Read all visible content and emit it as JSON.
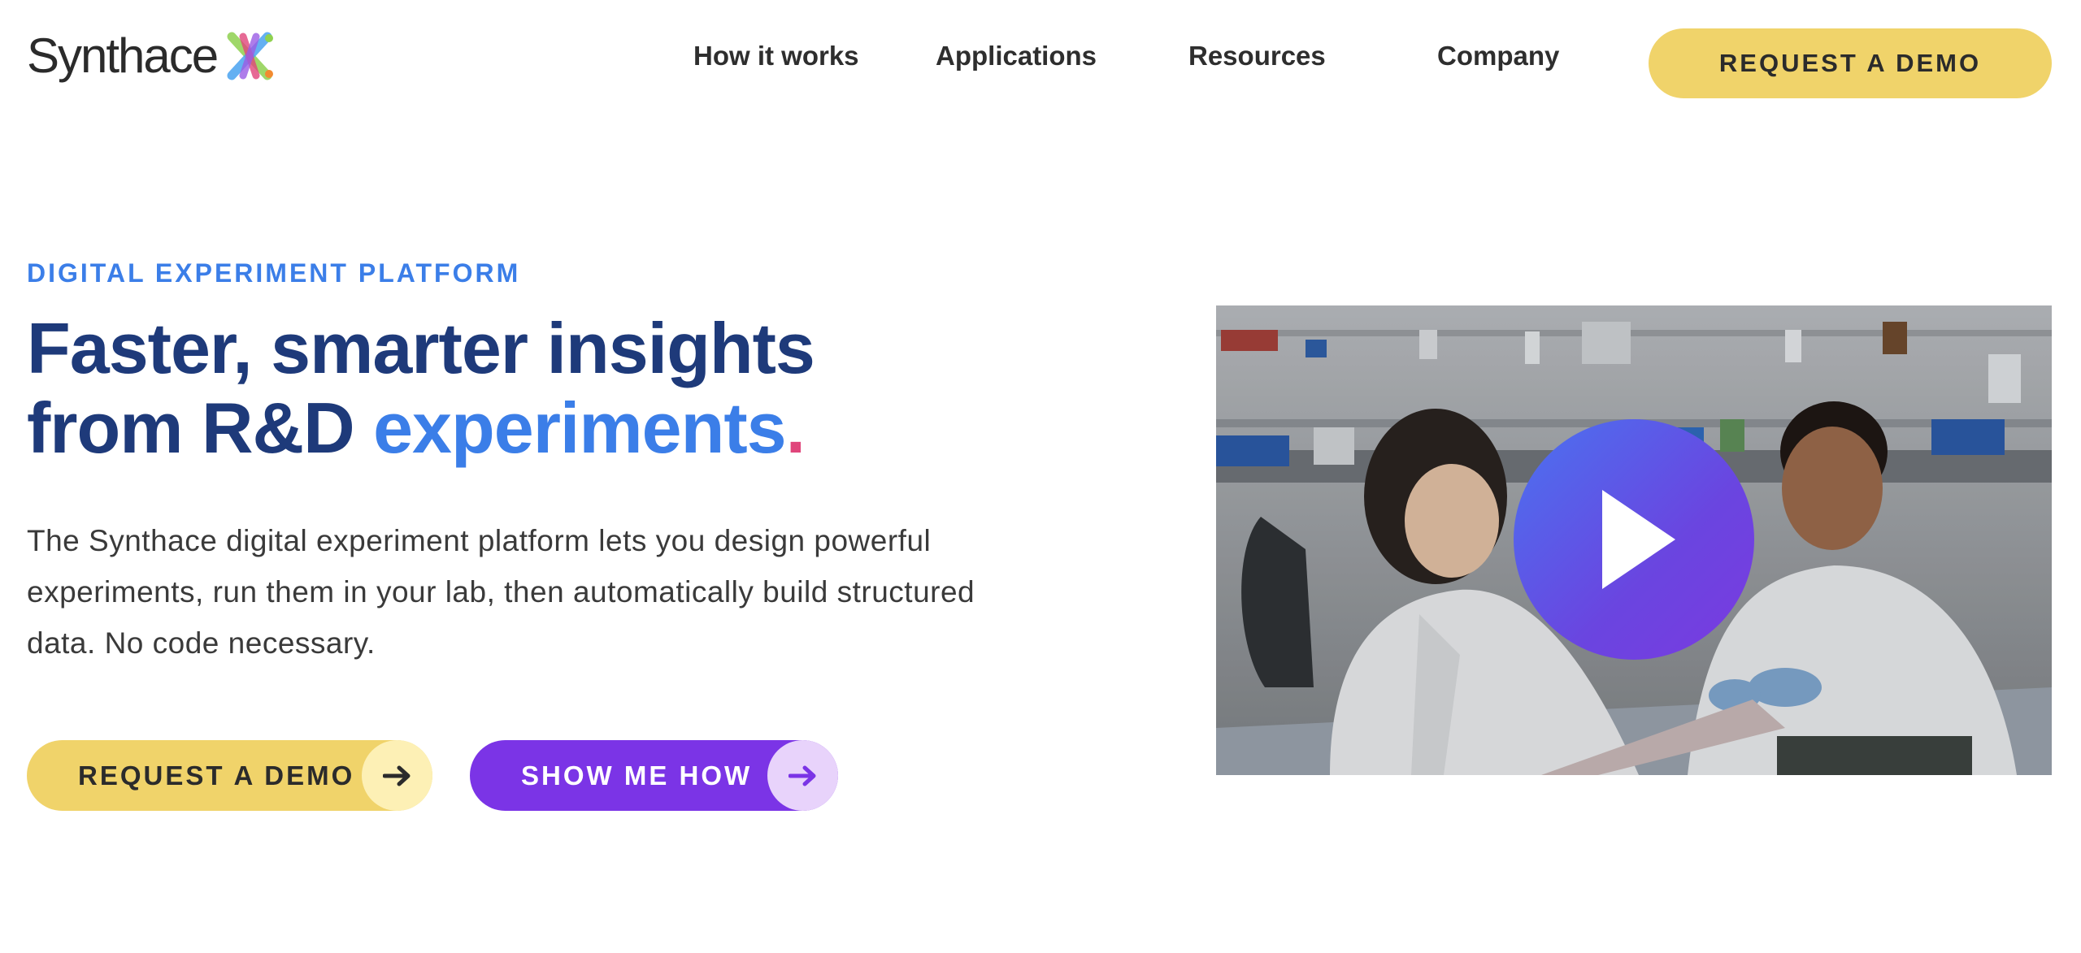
{
  "brand": {
    "name": "Synthace",
    "logo_icon": "synthace-x-mark-icon"
  },
  "nav": {
    "items": [
      {
        "label": "How it works"
      },
      {
        "label": "Applications"
      },
      {
        "label": "Resources"
      },
      {
        "label": "Company"
      }
    ],
    "cta_label": "REQUEST A DEMO"
  },
  "hero": {
    "eyebrow": "DIGITAL EXPERIMENT PLATFORM",
    "headline_line1": "Faster, smarter insights",
    "headline_line2_prefix": "from R&D ",
    "headline_accent": "experiments",
    "headline_dot": ".",
    "description": "The Synthace digital experiment platform lets you design powerful experiments, run them in your lab, then automatically build structured data. No code necessary.",
    "primary_button": {
      "label": "REQUEST A DEMO",
      "icon": "arrow-right-icon"
    },
    "secondary_button": {
      "label": "SHOW ME HOW",
      "icon": "arrow-right-icon"
    },
    "video": {
      "thumbnail": "lab-scientists-photo",
      "play_icon": "play-icon"
    }
  },
  "colors": {
    "navy": "#1e3a7a",
    "blue_accent": "#3b7ee8",
    "pink_dot": "#e0457b",
    "yellow_button": "#f0d36a",
    "purple_button": "#7b34e6"
  }
}
